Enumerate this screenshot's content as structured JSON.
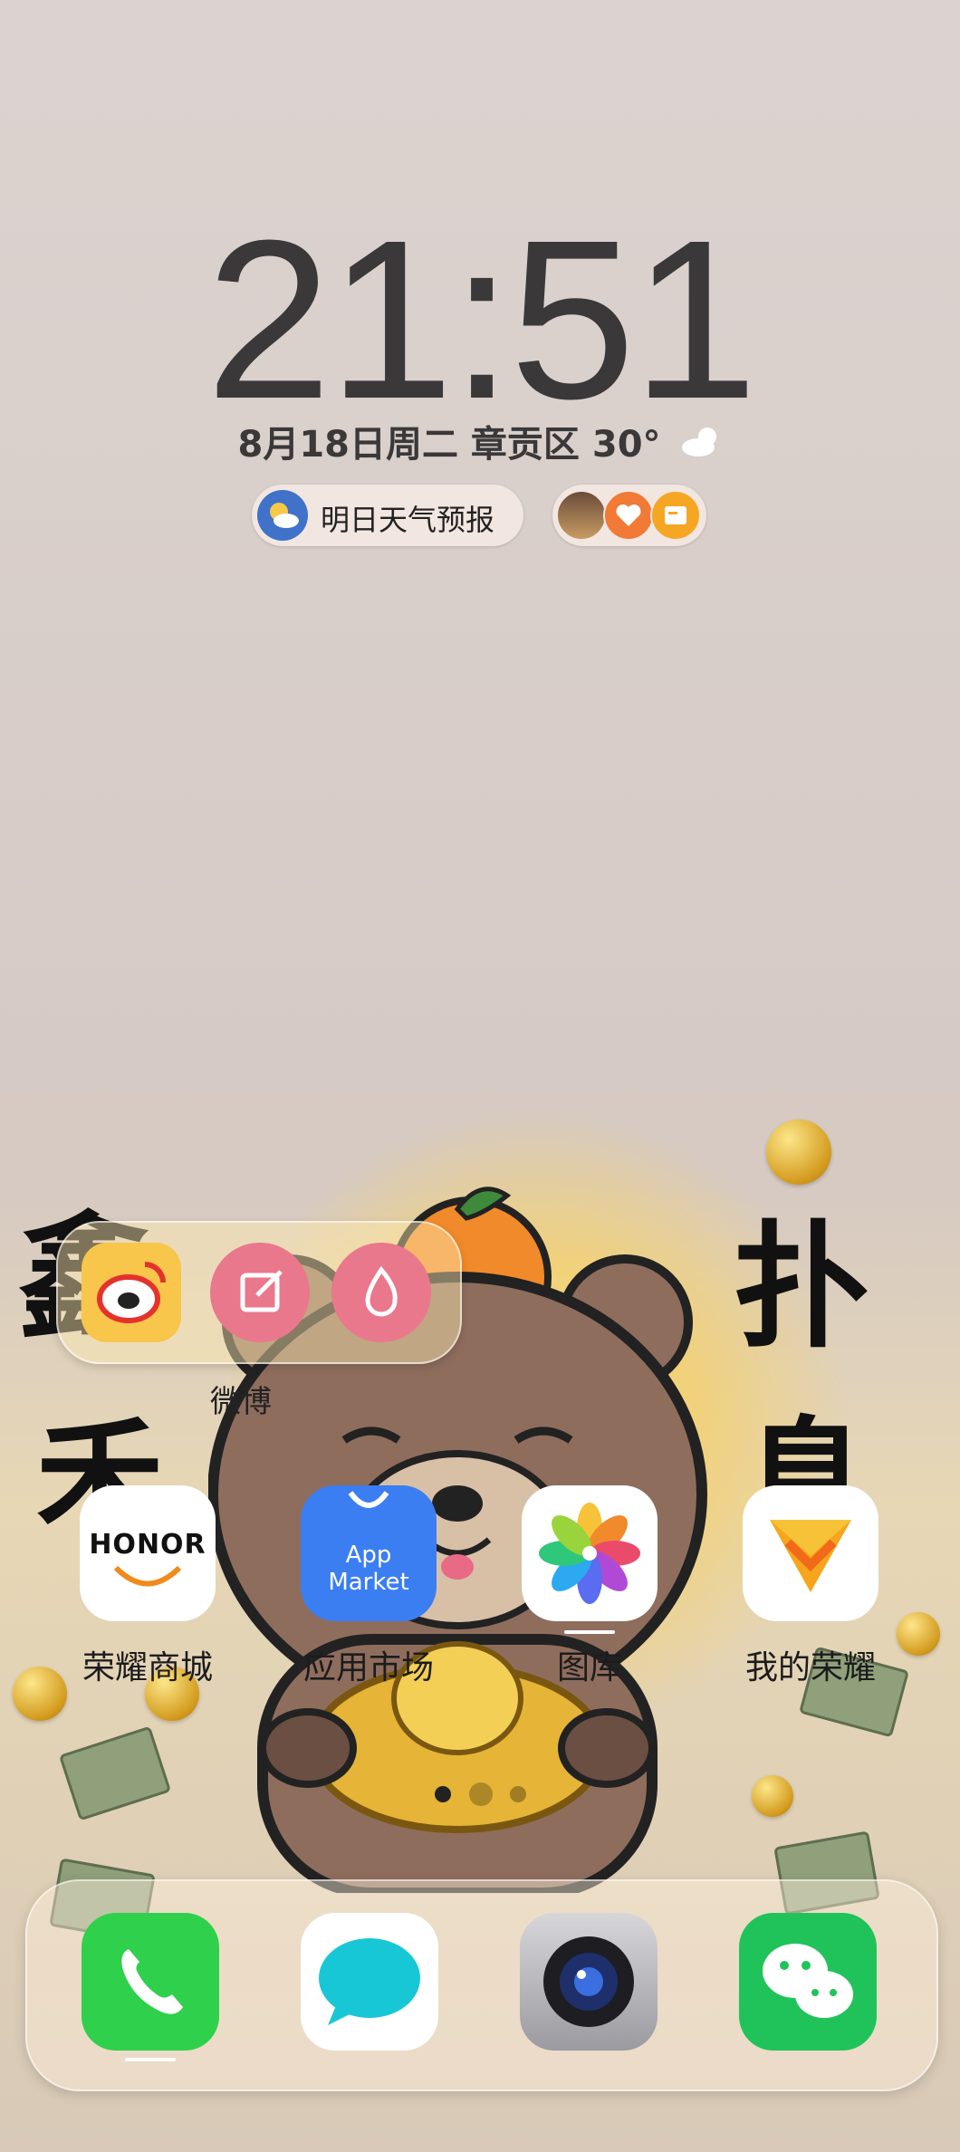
{
  "lockscreen": {
    "time": "21:51",
    "date_line": "8月18日周二  章贡区 30°"
  },
  "widgets": {
    "weather_pill_label": "明日天气预报"
  },
  "folder": {
    "label": "微博"
  },
  "apps": [
    {
      "label": "荣耀商城",
      "icon_text": "HONOR"
    },
    {
      "label": "应用市场",
      "icon_text_1": "App",
      "icon_text_2": "Market"
    },
    {
      "label": "图库"
    },
    {
      "label": "我的荣耀"
    }
  ],
  "dock": [
    "phone-icon",
    "messages-icon",
    "camera-icon",
    "wechat-icon"
  ],
  "pager": {
    "count": 3,
    "active": 1
  },
  "colors": {
    "clock": "#3a3839",
    "phone": "#2fd04b",
    "wechat": "#20c35a",
    "appmarket": "#3b7ef2"
  }
}
